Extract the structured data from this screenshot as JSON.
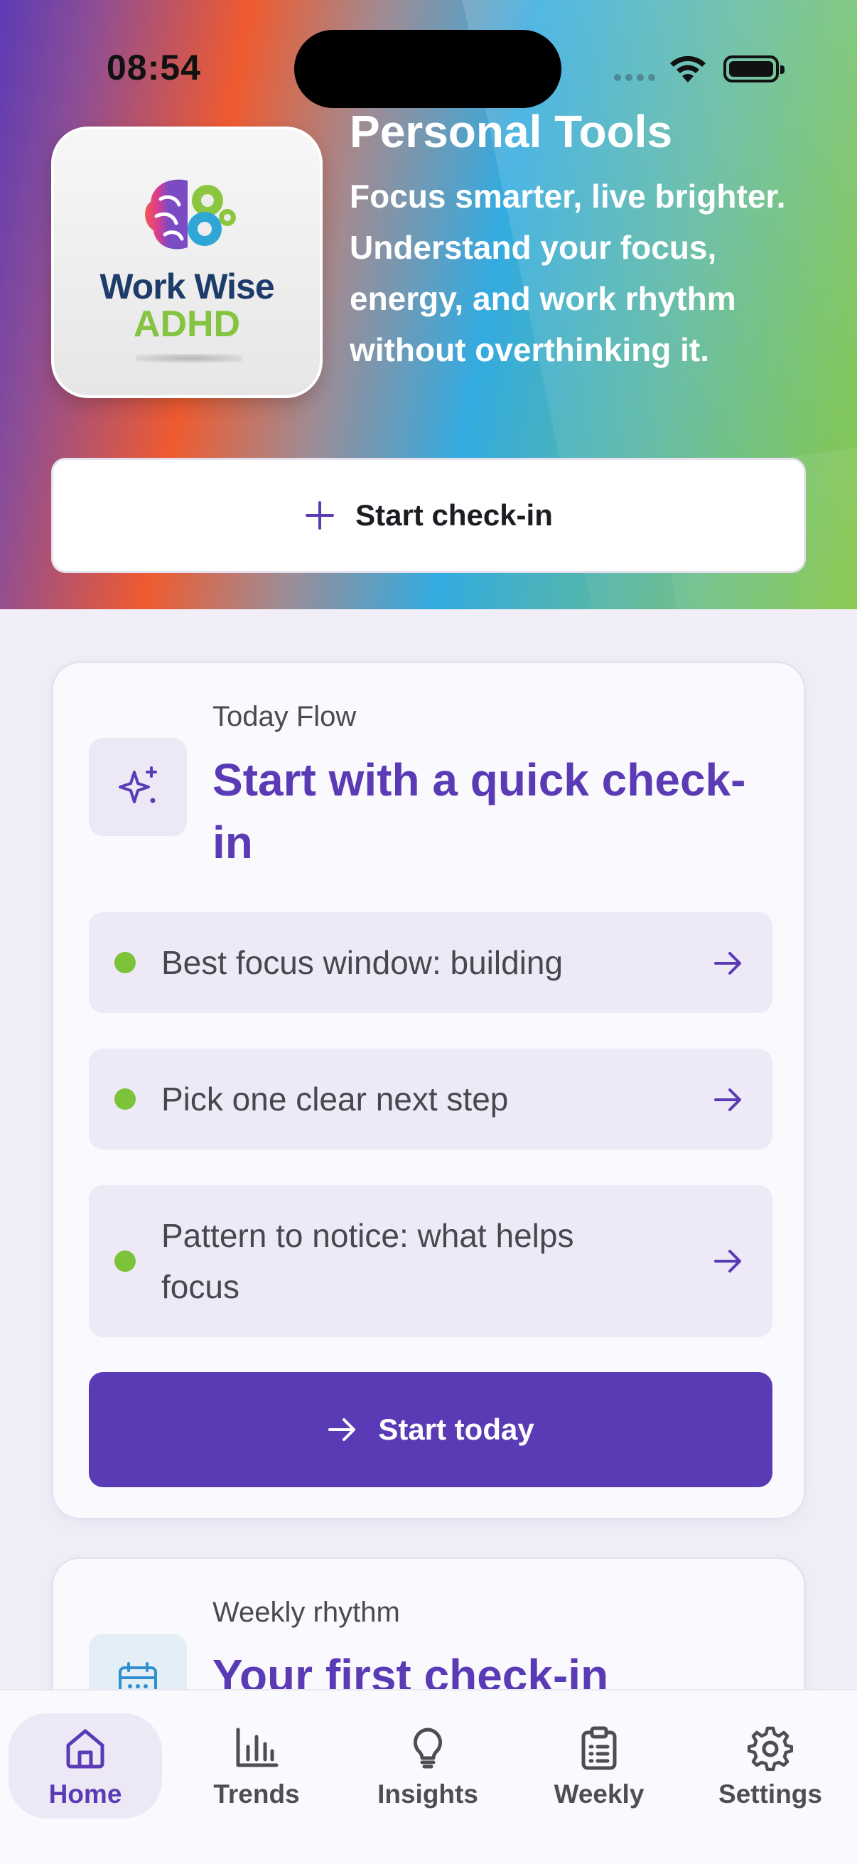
{
  "status_bar": {
    "time": "08:54"
  },
  "hero": {
    "logo_text_line1": "Work Wise",
    "logo_text_line2": "ADHD",
    "title": "Personal Tools",
    "subtitle": "Focus smarter, live brighter. Understand your focus, energy, and work rhythm without overthinking it.",
    "button_label": "Start check-in"
  },
  "today_flow": {
    "eyebrow": "Today Flow",
    "title": "Start with a quick check-in",
    "items": [
      {
        "label": "Best focus window: building"
      },
      {
        "label": "Pick one clear next step"
      },
      {
        "label": "Pattern to notice: what helps focus"
      }
    ],
    "button_label": "Start today"
  },
  "weekly_rhythm": {
    "eyebrow": "Weekly rhythm",
    "title": "Your first check-in"
  },
  "bottom_nav": {
    "items": [
      {
        "label": "Home",
        "icon": "home-icon",
        "active": true
      },
      {
        "label": "Trends",
        "icon": "bar-chart-icon"
      },
      {
        "label": "Insights",
        "icon": "lightbulb-icon"
      },
      {
        "label": "Weekly",
        "icon": "clipboard-icon"
      },
      {
        "label": "Settings",
        "icon": "gear-icon"
      }
    ]
  },
  "colors": {
    "accent": "#5a3bb5",
    "dot_green": "#7dc33a",
    "card_bg": "#faf9fd",
    "item_bg": "#ede9f6"
  }
}
